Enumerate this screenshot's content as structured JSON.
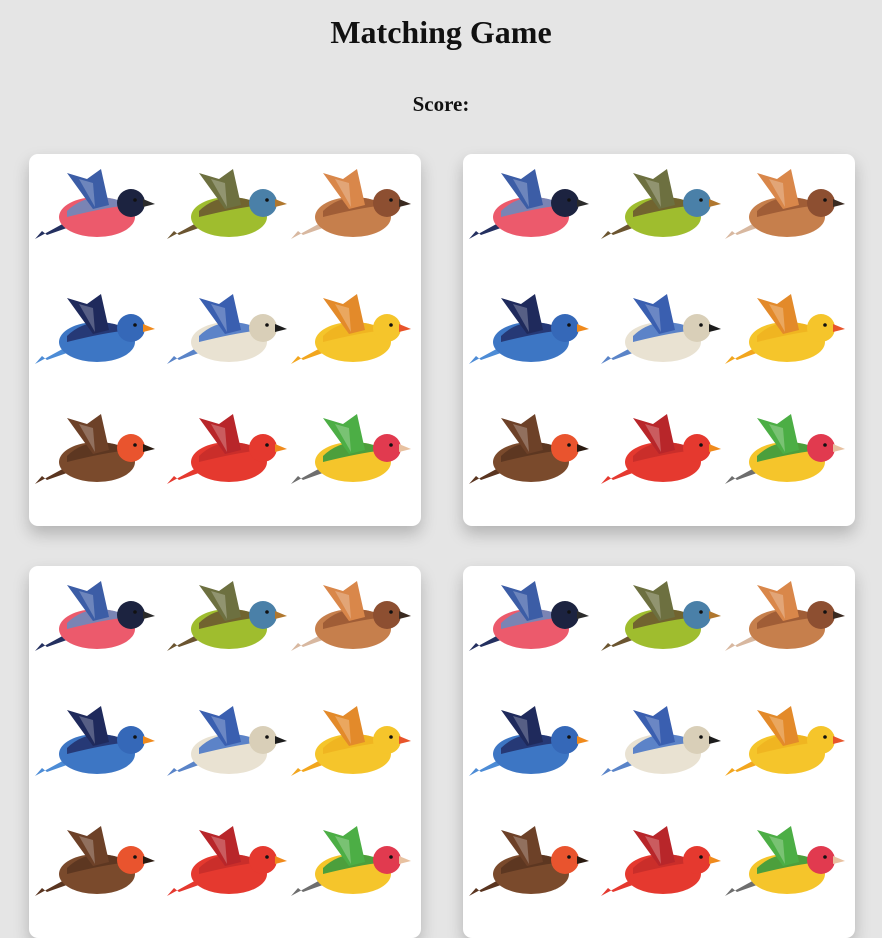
{
  "title": "Matching Game",
  "score_label": "Score:",
  "birds": [
    {
      "name": "bullfinch",
      "body": "#ec5a6c",
      "back": "#6e88bd",
      "head": "#1c2340",
      "wing": "#3c5da6",
      "tail": "#243060",
      "beak": "#2b2b2b"
    },
    {
      "name": "green-finch",
      "body": "#9fbd2e",
      "back": "#6b5a30",
      "head": "#4a80a8",
      "wing": "#6d7040",
      "tail": "#6b5530",
      "beak": "#b0772e"
    },
    {
      "name": "sparrow",
      "body": "#c67f4c",
      "back": "#9b5a34",
      "head": "#8d4f31",
      "wing": "#d9874a",
      "tail": "#d8b8a0",
      "beak": "#3a2a20"
    },
    {
      "name": "bluebird",
      "body": "#3d76c4",
      "back": "#24336e",
      "head": "#3568b8",
      "wing": "#1f2a5c",
      "tail": "#4d8cd6",
      "beak": "#f08a1c"
    },
    {
      "name": "blue-jay",
      "body": "#e9e2d2",
      "back": "#4d79c7",
      "head": "#d9cfb8",
      "wing": "#3a5fb0",
      "tail": "#5a84c8",
      "beak": "#1c1c1c"
    },
    {
      "name": "yellow-finch",
      "body": "#f5c52b",
      "back": "#f0b320",
      "head": "#f5c52b",
      "wing": "#e38a2a",
      "tail": "#f2a61e",
      "beak": "#e8542a"
    },
    {
      "name": "robin",
      "body": "#7a4a2c",
      "back": "#5a3520",
      "head": "#e9542e",
      "wing": "#6d4128",
      "tail": "#5a3520",
      "beak": "#2a1a10"
    },
    {
      "name": "cardinal",
      "body": "#e5392f",
      "back": "#c62d2a",
      "head": "#e5392f",
      "wing": "#b8262a",
      "tail": "#e5392f",
      "beak": "#f08a1c"
    },
    {
      "name": "gouldian-finch",
      "body": "#f5c52b",
      "back": "#3a9a3e",
      "head": "#e13a4f",
      "wing": "#4cae45",
      "tail": "#6e6e6e",
      "beak": "#e8c1a0"
    }
  ]
}
